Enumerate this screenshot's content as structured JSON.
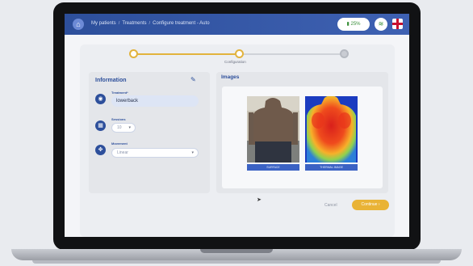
{
  "header": {
    "breadcrumbs": [
      "My patients",
      "Treatments",
      "Configure treatment - Auto"
    ],
    "battery": "25%",
    "icons": {
      "home": "home-icon",
      "wifi": "wifi-icon",
      "flag": "uk-flag-icon"
    }
  },
  "stepper": {
    "steps": [
      {
        "label": "",
        "state": "done"
      },
      {
        "label": "Configuration",
        "state": "active"
      },
      {
        "label": "",
        "state": "todo"
      }
    ]
  },
  "information": {
    "title": "Information",
    "treatment": {
      "label": "Treatment*",
      "value": "lowerback",
      "icon": "camera-icon"
    },
    "sessions": {
      "label": "Sessions",
      "value": "10",
      "icon": "calendar-icon"
    },
    "movement": {
      "label": "Movement",
      "value": "Linear",
      "icon": "move-icon"
    }
  },
  "images": {
    "title": "Images",
    "items": [
      {
        "caption": "SURFACE"
      },
      {
        "caption": "THERMAL IMAGE"
      }
    ]
  },
  "actions": {
    "cancel": "Cancel",
    "continue": "Continue"
  },
  "colors": {
    "header": "#2d4f9b",
    "accent": "#e9b336",
    "caption_bar": "#3b62c4"
  }
}
